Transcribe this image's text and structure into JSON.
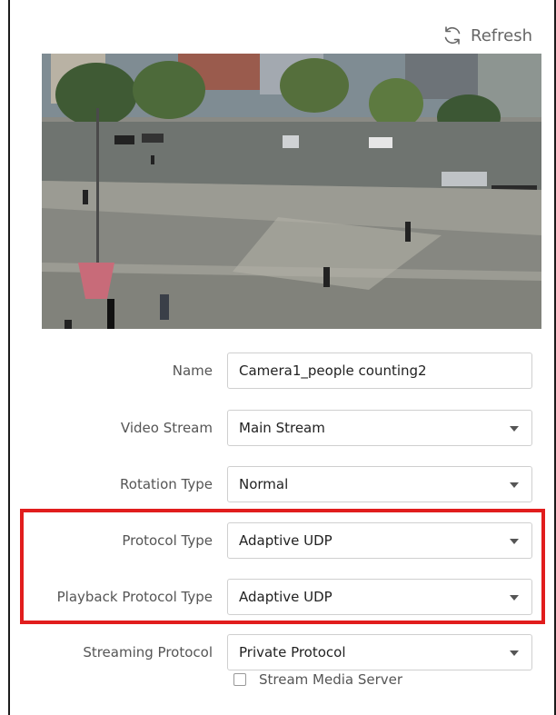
{
  "header": {
    "refresh_label": "Refresh",
    "refresh_icon": "refresh-icon"
  },
  "preview": {
    "alt": "camera live view - plaza with pedestrians"
  },
  "form": {
    "name": {
      "label": "Name",
      "value": "Camera1_people counting2"
    },
    "video_stream": {
      "label": "Video Stream",
      "value": "Main Stream"
    },
    "rotation_type": {
      "label": "Rotation Type",
      "value": "Normal"
    },
    "protocol_type": {
      "label": "Protocol Type",
      "value": "Adaptive UDP"
    },
    "playback_protocol_type": {
      "label": "Playback Protocol Type",
      "value": "Adaptive UDP"
    },
    "streaming_protocol": {
      "label": "Streaming Protocol",
      "value": "Private Protocol"
    },
    "stream_media_server": {
      "label": "Stream Media Server",
      "checked": false
    }
  },
  "colors": {
    "highlight": "#e11d1d",
    "border": "#cfcfcf"
  }
}
